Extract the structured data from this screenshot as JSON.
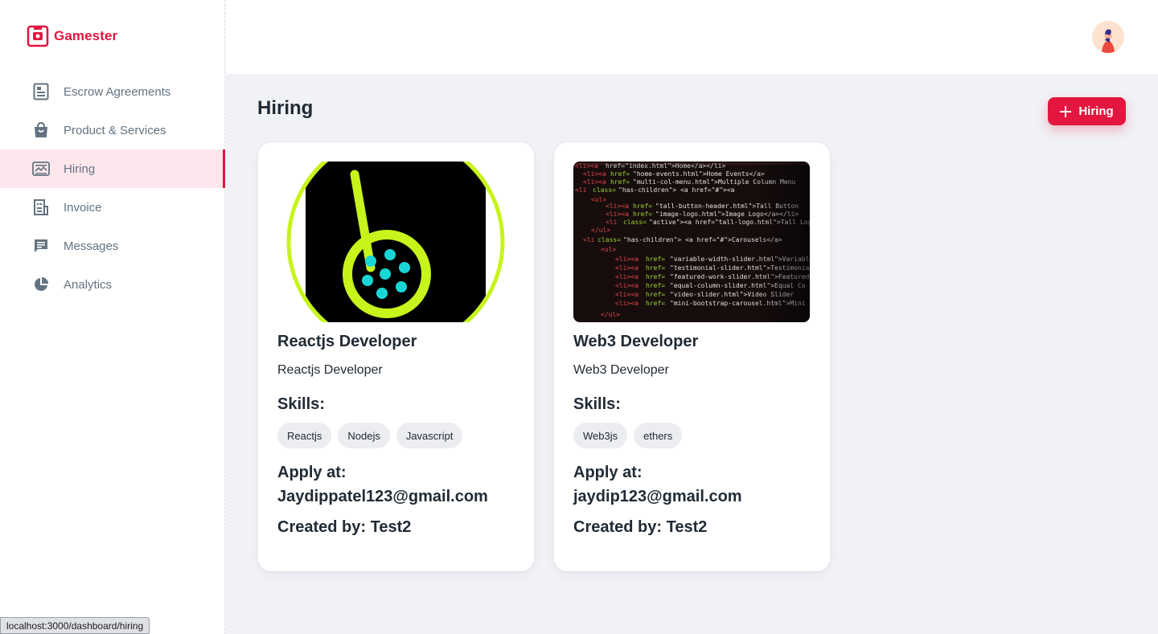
{
  "app": {
    "name": "Gamester",
    "brand_color": "#e3163f"
  },
  "sidebar": {
    "items": [
      {
        "label": "Escrow Agreements",
        "icon": "document-icon",
        "active": false
      },
      {
        "label": "Product & Services",
        "icon": "bag-icon",
        "active": false
      },
      {
        "label": "Hiring",
        "icon": "hiring-icon",
        "active": true
      },
      {
        "label": "Invoice",
        "icon": "invoice-icon",
        "active": false
      },
      {
        "label": "Messages",
        "icon": "message-icon",
        "active": false
      },
      {
        "label": "Analytics",
        "icon": "pie-chart-icon",
        "active": false
      }
    ]
  },
  "header": {
    "avatar": "user-avatar"
  },
  "main": {
    "title": "Hiring",
    "add_button_label": "Hiring",
    "cards": [
      {
        "title": "Reactjs Developer",
        "subtitle": "Reactjs Developer",
        "skills_label": "Skills:",
        "skills": [
          "Reactjs",
          "Nodejs",
          "Javascript"
        ],
        "apply_label": "Apply at:",
        "apply_email": "Jaydippatel123@gmail.com",
        "created_by": "Created by: Test2",
        "image": "logo-image"
      },
      {
        "title": "Web3 Developer",
        "subtitle": "Web3 Developer",
        "skills_label": "Skills:",
        "skills": [
          "Web3js",
          "ethers"
        ],
        "apply_label": "Apply at:",
        "apply_email": "jaydip123@gmail.com",
        "created_by": "Created by: Test2",
        "image": "code-screenshot-image"
      }
    ]
  },
  "status_bar": {
    "url": "localhost:3000/dashboard/hiring"
  }
}
